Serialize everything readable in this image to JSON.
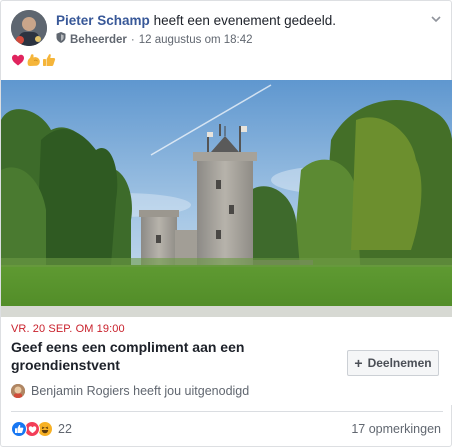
{
  "header": {
    "author": "Pieter Schamp",
    "action_text": "heeft een evenement gedeeld.",
    "role": "Beheerder",
    "date": "12 augustus om 18:42"
  },
  "reaction_emojis": [
    "heart-emoji",
    "flexed-biceps-emoji",
    "thumbs-up-emoji"
  ],
  "event": {
    "date": "VR. 20 SEP. OM 19:00",
    "title": "Geef eens een compliment aan een groendienstvent",
    "invite_text": "Benjamin Rogiers heeft jou uitgenodigd",
    "join_label": "Deelnemen"
  },
  "footer": {
    "reaction_count": "22",
    "comments": "17 opmerkingen"
  },
  "colors": {
    "author_link": "#385898",
    "event_date": "#c9212c",
    "like_blue": "#1877f2",
    "love_red": "#f33e58",
    "haha_yellow": "#f7b125"
  }
}
